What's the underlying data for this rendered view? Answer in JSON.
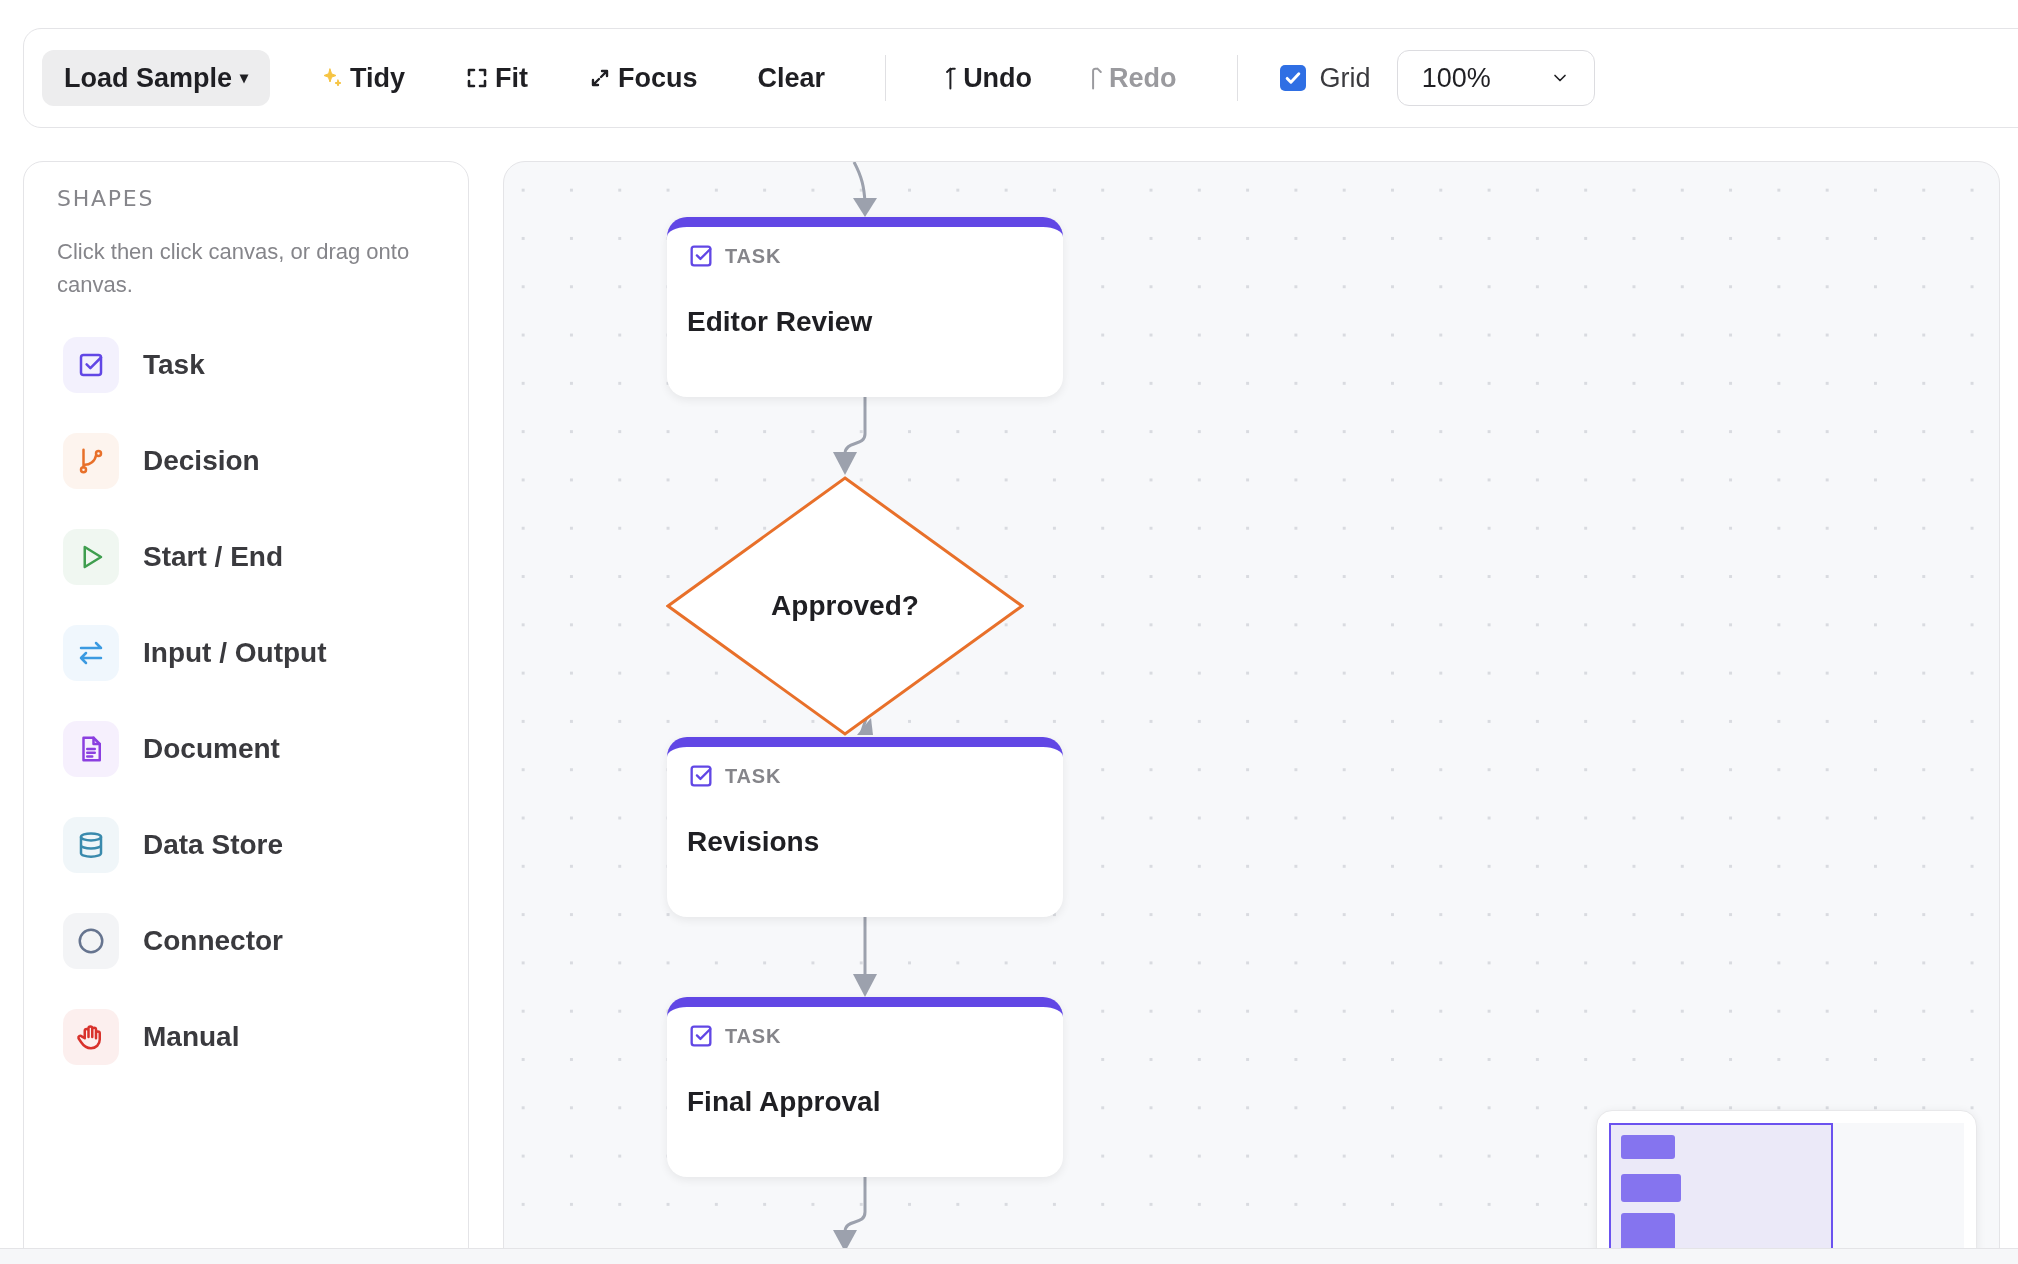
{
  "toolbar": {
    "items": [
      {
        "kind": "dropdown",
        "label": "Load Sample",
        "caret": "▾"
      },
      {
        "kind": "tidy",
        "label": "Tidy",
        "disabled": false
      },
      {
        "kind": "fit",
        "label": "Fit",
        "disabled": false
      },
      {
        "kind": "focus",
        "label": "Focus",
        "disabled": false
      },
      {
        "kind": "plain",
        "label": "Clear",
        "disabled": false
      },
      {
        "kind": "separator"
      },
      {
        "kind": "undo",
        "label": "Undo",
        "disabled": false
      },
      {
        "kind": "redo",
        "label": "Redo",
        "disabled": true
      },
      {
        "kind": "separator"
      },
      {
        "kind": "checkbox",
        "label": "Grid",
        "checked": true
      },
      {
        "kind": "select",
        "value": "100%"
      }
    ]
  },
  "sidebar": {
    "title": "SHAPES",
    "hint": "Click then click canvas, or drag onto canvas.",
    "items": [
      {
        "kind": "task",
        "label": "Task",
        "color": "#6147e5"
      },
      {
        "kind": "decision",
        "label": "Decision",
        "color": "#e8702a"
      },
      {
        "kind": "start",
        "label": "Start / End",
        "color": "#3f9e4f"
      },
      {
        "kind": "io",
        "label": "Input / Output",
        "color": "#3b9ae1"
      },
      {
        "kind": "document",
        "label": "Document",
        "color": "#8b3fe0"
      },
      {
        "kind": "datastore",
        "label": "Data Store",
        "color": "#3a8aad"
      },
      {
        "kind": "connector",
        "label": "Connector",
        "color": "#66748f"
      },
      {
        "kind": "manual",
        "label": "Manual",
        "color": "#d8322c"
      }
    ]
  },
  "canvas": {
    "nodes": [
      {
        "kind": "task",
        "type_label": "TASK",
        "label": "Editor Review"
      },
      {
        "kind": "decision",
        "label": "Approved?"
      },
      {
        "kind": "task",
        "type_label": "TASK",
        "label": "Revisions"
      },
      {
        "kind": "task",
        "type_label": "TASK",
        "label": "Final Approval"
      }
    ]
  }
}
